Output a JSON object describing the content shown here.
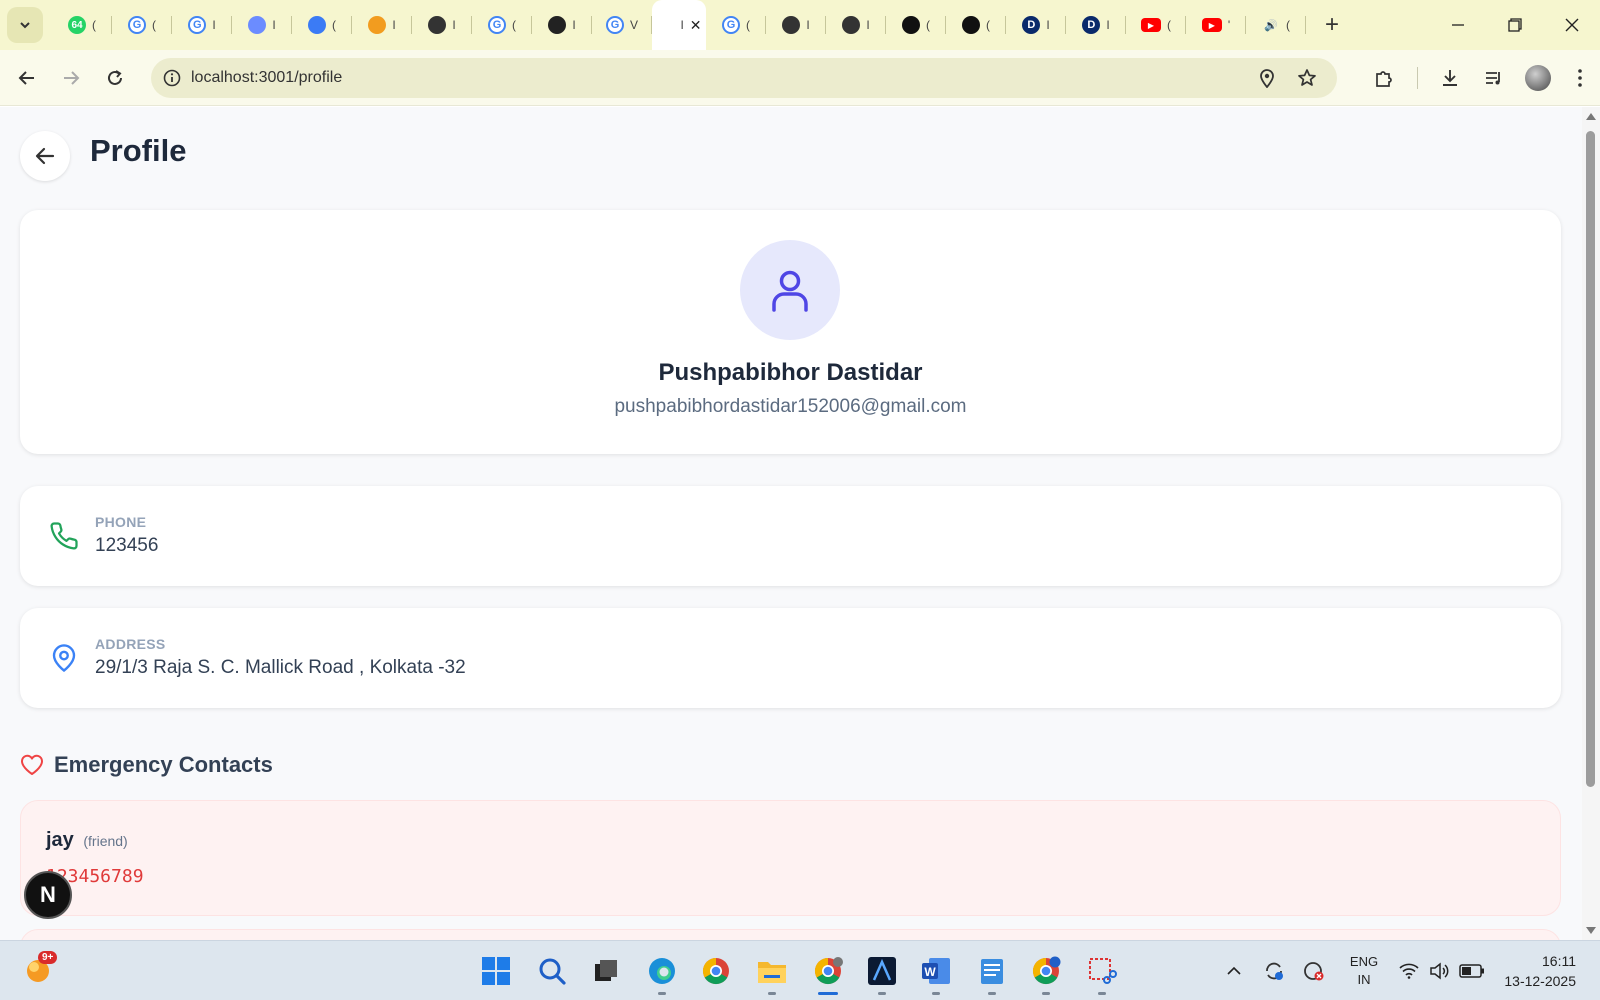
{
  "browser": {
    "tabs": [
      {
        "icon": "whatsapp-icon",
        "badge": "64",
        "short": "("
      },
      {
        "icon": "google-icon",
        "short": "("
      },
      {
        "icon": "google-icon",
        "short": "I"
      },
      {
        "icon": "extension-icon",
        "short": "I"
      },
      {
        "icon": "gemini-icon",
        "short": "("
      },
      {
        "icon": "cloud-icon",
        "short": "I"
      },
      {
        "icon": "chatgpt-icon",
        "short": "I"
      },
      {
        "icon": "google-icon",
        "short": "("
      },
      {
        "icon": "openai-icon",
        "short": "I"
      },
      {
        "icon": "google-icon",
        "short": "V"
      },
      {
        "icon": "active-page-icon",
        "short": "I",
        "active": true
      },
      {
        "icon": "google-icon",
        "short": "("
      },
      {
        "icon": "chatgpt-icon",
        "short": "I"
      },
      {
        "icon": "chatgpt-icon",
        "short": "I"
      },
      {
        "icon": "github-icon",
        "short": "("
      },
      {
        "icon": "github-icon",
        "short": "("
      },
      {
        "icon": "dev-icon",
        "short": "I"
      },
      {
        "icon": "dev-icon",
        "short": "I"
      },
      {
        "icon": "youtube-icon",
        "short": "("
      },
      {
        "icon": "youtube-icon",
        "short": "'"
      },
      {
        "icon": "audio-icon",
        "short": "("
      }
    ],
    "url": "localhost:3001/profile"
  },
  "page": {
    "title": "Profile",
    "user": {
      "name": "Pushpabibhor Dastidar",
      "email": "pushpabibhordastidar152006@gmail.com"
    },
    "phone": {
      "label": "PHONE",
      "value": "123456"
    },
    "address": {
      "label": "ADDRESS",
      "value": "29/1/3 Raja S. C. Mallick Road , Kolkata -32"
    },
    "emergency": {
      "title": "Emergency Contacts",
      "contacts": [
        {
          "name": "jay",
          "relation": "(friend)",
          "phone": "123456789"
        }
      ]
    },
    "next_badge": "N"
  },
  "taskbar": {
    "weather_badge": "9+",
    "language": "ENG",
    "region": "IN",
    "time": "16:11",
    "date": "13-12-2025"
  },
  "colors": {
    "accent": "#4f46e5",
    "phone_icon": "#22a35a",
    "address_icon": "#3b82f6",
    "heart_icon": "#ef4444",
    "emergency_bg": "#fef2f2",
    "emergency_phone": "#e03a3a"
  }
}
